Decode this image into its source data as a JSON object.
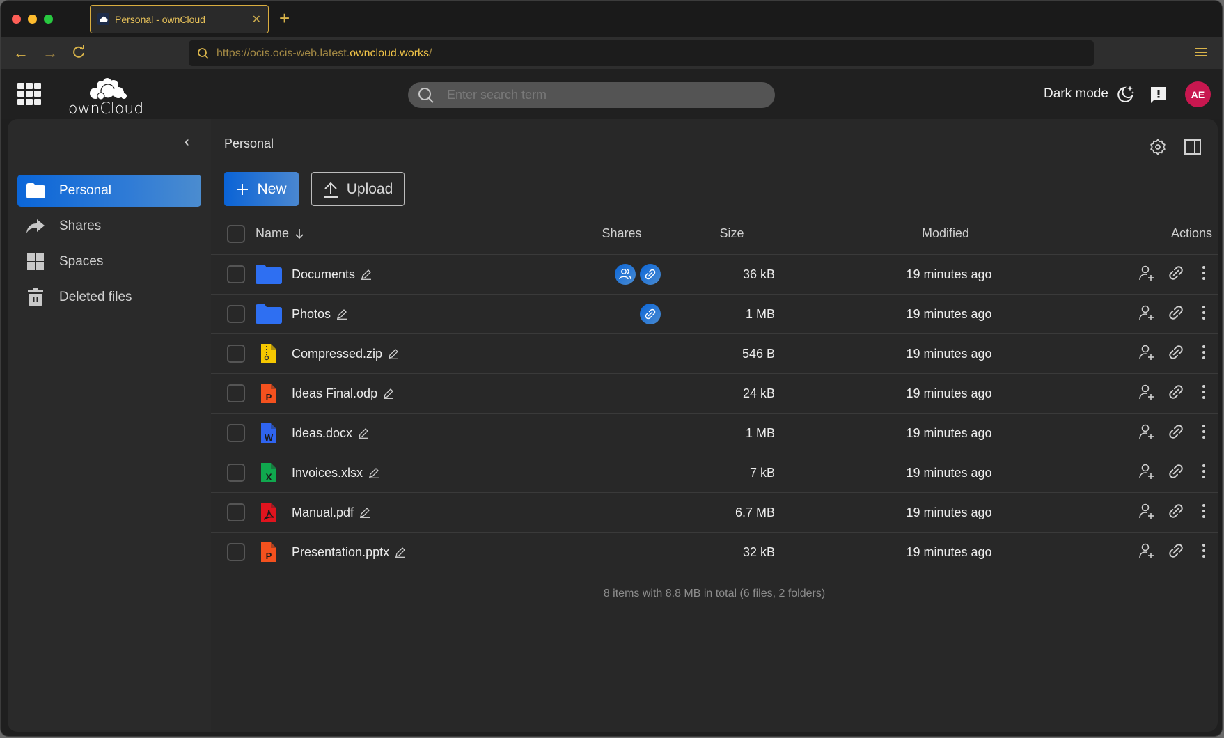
{
  "browser": {
    "tab_title": "Personal - ownCloud",
    "url_prefix": "https://ocis.ocis-web.latest.",
    "url_domain": "owncloud.works",
    "url_suffix": "/"
  },
  "header": {
    "logo_text": "ownCloud",
    "search_placeholder": "Enter search term",
    "dark_mode_label": "Dark mode",
    "avatar_initials": "AE"
  },
  "sidebar": {
    "items": [
      {
        "label": "Personal",
        "icon": "folder-icon",
        "active": true
      },
      {
        "label": "Shares",
        "icon": "share-arrow-icon",
        "active": false
      },
      {
        "label": "Spaces",
        "icon": "spaces-grid-icon",
        "active": false
      },
      {
        "label": "Deleted files",
        "icon": "trash-icon",
        "active": false
      }
    ]
  },
  "main": {
    "breadcrumb": "Personal",
    "new_label": "New",
    "upload_label": "Upload",
    "columns": {
      "name": "Name",
      "shares": "Shares",
      "size": "Size",
      "modified": "Modified",
      "actions": "Actions"
    },
    "files": [
      {
        "name": "Documents",
        "type": "folder",
        "shares": [
          "people",
          "link"
        ],
        "size": "36 kB",
        "modified": "19 minutes ago"
      },
      {
        "name": "Photos",
        "type": "folder",
        "shares": [
          "link"
        ],
        "size": "1 MB",
        "modified": "19 minutes ago"
      },
      {
        "name": "Compressed.zip",
        "type": "zip",
        "shares": [],
        "size": "546 B",
        "modified": "19 minutes ago"
      },
      {
        "name": "Ideas Final.odp",
        "type": "presentation",
        "shares": [],
        "size": "24 kB",
        "modified": "19 minutes ago"
      },
      {
        "name": "Ideas.docx",
        "type": "word",
        "shares": [],
        "size": "1 MB",
        "modified": "19 minutes ago"
      },
      {
        "name": "Invoices.xlsx",
        "type": "excel",
        "shares": [],
        "size": "7 kB",
        "modified": "19 minutes ago"
      },
      {
        "name": "Manual.pdf",
        "type": "pdf",
        "shares": [],
        "size": "6.7 MB",
        "modified": "19 minutes ago"
      },
      {
        "name": "Presentation.pptx",
        "type": "presentation",
        "shares": [],
        "size": "32 kB",
        "modified": "19 minutes ago"
      }
    ],
    "footer": "8 items with 8.8 MB in total (6 files, 2 folders)"
  },
  "colors": {
    "accent": "#0b66d8",
    "avatar": "#c8174f",
    "browser_accent": "#d9b44a",
    "folder": "#2e6ff2",
    "zip": "#f6c800",
    "presentation": "#f4511e",
    "word": "#2f64f0",
    "excel": "#10a84e",
    "pdf": "#e0141e"
  }
}
